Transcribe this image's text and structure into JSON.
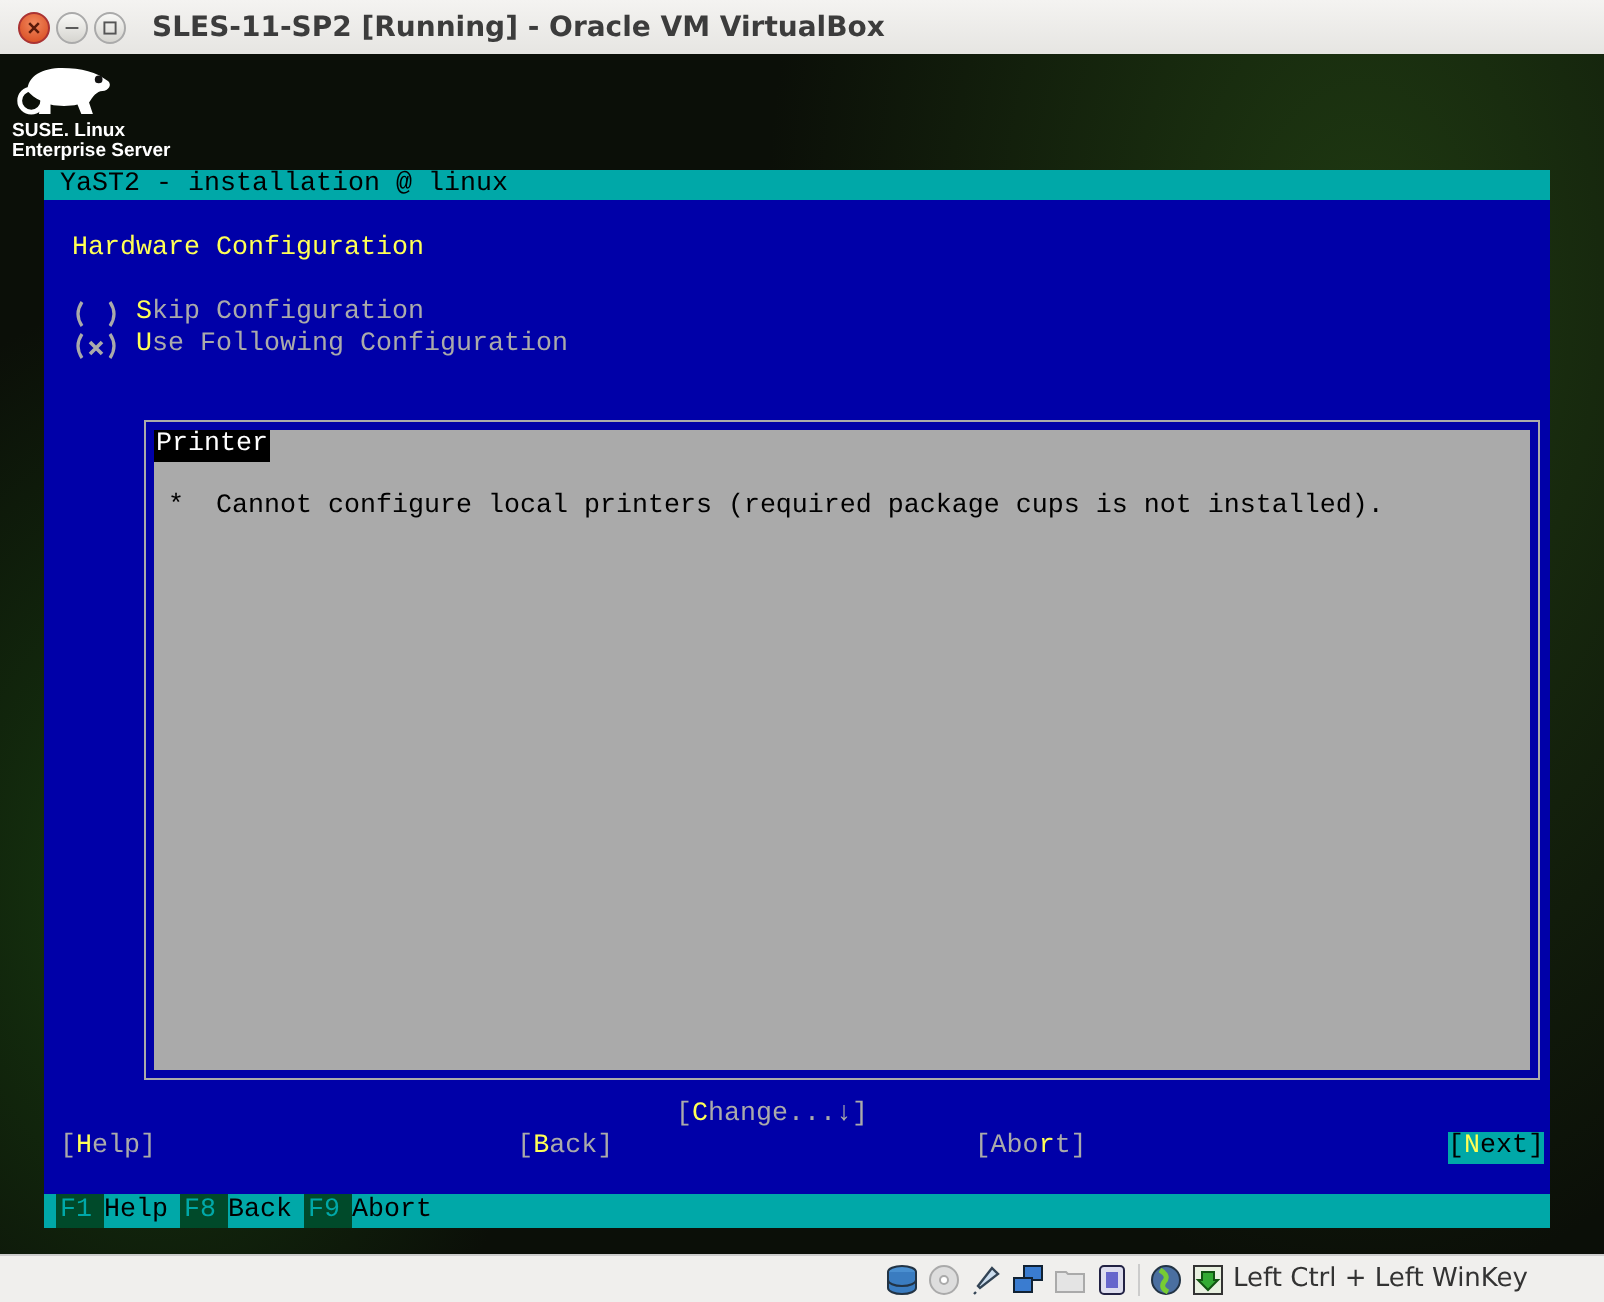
{
  "window": {
    "title": "SLES-11-SP2 [Running] - Oracle VM VirtualBox"
  },
  "logo": {
    "line_1": "SUSE. Linux",
    "line_2": "Enterprise Server"
  },
  "yast": {
    "title": "YaST2 - installation @ linux",
    "heading": "Hardware Configuration",
    "options": [
      {
        "label": "**S**kip Configuration",
        "selected": false
      },
      {
        "label": "**U**se Following Configuration",
        "selected": true
      }
    ],
    "section": {
      "title": "Printer",
      "items": [
        {
          "bullet": "*",
          "text": "Cannot configure local printers (required package cups is not installed)."
        }
      ]
    },
    "change_button": "[**C**hange...↓]",
    "buttons": [
      {
        "label": "[**H**elp]",
        "focused": false
      },
      {
        "label": "[**B**ack]",
        "focused": false
      },
      {
        "label": "[Abo**r**t]",
        "focused": false
      },
      {
        "label": "[**N**ext]",
        "focused": true
      }
    ],
    "function_keys": [
      {
        "key": "F1",
        "label": "Help"
      },
      {
        "key": "F8",
        "label": "Back"
      },
      {
        "key": "F9",
        "label": "Abort"
      }
    ]
  },
  "status_bar": {
    "host_key": "Left Ctrl + Left WinKey"
  }
}
